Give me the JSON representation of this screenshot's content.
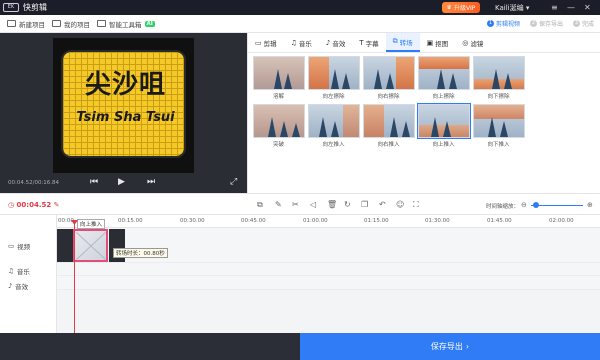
{
  "app": {
    "logo_text": "EK",
    "name": "快剪辑"
  },
  "titlebar": {
    "vip_label": "升级VIP",
    "user_name": "Kaili涎编",
    "controls": [
      "≡",
      "—",
      "✕"
    ]
  },
  "toolbar": {
    "new_project": "新建项目",
    "my_projects": "我的项目",
    "smart_toolbox": "智能工具箱",
    "ai_badge": "AI",
    "steps": [
      {
        "num": "1",
        "label": "剪辑视频"
      },
      {
        "num": "2",
        "label": "保存导出"
      },
      {
        "num": "3",
        "label": "完成"
      }
    ]
  },
  "preview": {
    "sign_cn": "尖沙咀",
    "sign_en": "Tsim Sha Tsui",
    "timecode": "00:04.52/00:16.84"
  },
  "panel": {
    "tabs": [
      {
        "icon": "▭",
        "label": "剪辑"
      },
      {
        "icon": "♫",
        "label": "音乐"
      },
      {
        "icon": "♪",
        "label": "音效"
      },
      {
        "icon": "T",
        "label": "字幕"
      },
      {
        "icon": "⧉",
        "label": "转场"
      },
      {
        "icon": "▣",
        "label": "抠图"
      },
      {
        "icon": "◎",
        "label": "滤镜"
      }
    ],
    "transitions": [
      "溶解",
      "向左擦除",
      "向右擦除",
      "向上擦除",
      "向下擦除",
      "突破",
      "向左推入",
      "向右推入",
      "向上推入",
      "向下推入"
    ]
  },
  "timeline": {
    "current_time": "00:04.52",
    "zoom_label": "时间轴缩放：",
    "ruler": [
      "00:00",
      "00:15.00",
      "00:30.00",
      "00:45.00",
      "01:00.00",
      "01:15.00",
      "01:30.00",
      "01:45.00",
      "02:00.00"
    ],
    "tracks": [
      {
        "icon": "▭",
        "label": "视频"
      },
      {
        "icon": "♫",
        "label": "音乐"
      },
      {
        "icon": "♪",
        "label": "音效"
      }
    ],
    "transition_tip": "向上推入",
    "duration_tip": "转场时长：00.80秒"
  },
  "export": {
    "label": "保存导出",
    "arrow": "›"
  },
  "colors": {
    "accent": "#2f7cf6",
    "playhead": "#e23b47",
    "vip": "#ff6a2a"
  }
}
